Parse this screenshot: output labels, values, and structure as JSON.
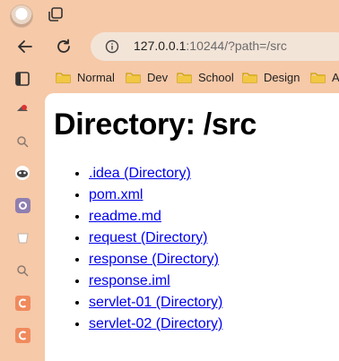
{
  "browser": {
    "url_host": "127.0.0.1",
    "url_rest": ":10244/?path=/src"
  },
  "bookmarks": [
    {
      "label": "Normal"
    },
    {
      "label": "Dev"
    },
    {
      "label": "School"
    },
    {
      "label": "Design"
    },
    {
      "label": "A"
    }
  ],
  "page": {
    "heading": "Directory: /src",
    "entries": [
      {
        "label": ".idea (Directory)"
      },
      {
        "label": "pom.xml"
      },
      {
        "label": "readme.md"
      },
      {
        "label": "request (Directory)"
      },
      {
        "label": "response (Directory)"
      },
      {
        "label": "response.iml"
      },
      {
        "label": "servlet-01 (Directory)"
      },
      {
        "label": "servlet-02 (Directory)"
      }
    ]
  },
  "colors": {
    "chrome_bg": "#f6c9a8",
    "address_bg": "#f3e4d8",
    "link": "#0000ee",
    "folder": "#f2c744",
    "sidebar_accent": "#f08a5d"
  }
}
